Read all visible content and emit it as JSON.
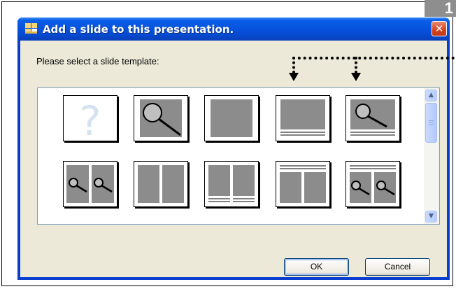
{
  "dialog": {
    "title": "Add a slide to this presentation.",
    "close_symbol": "✕",
    "prompt": "Please select a slide template:",
    "buttons": {
      "ok": "OK",
      "cancel": "Cancel"
    }
  },
  "corner_tab_text": "1",
  "templates": [
    {
      "name": "blank-question",
      "icon": "question-mark-icon"
    },
    {
      "name": "image-full",
      "icon": "magnifier-icon"
    },
    {
      "name": "full-gray",
      "icon": "gray-block-icon"
    },
    {
      "name": "gray-with-caption",
      "icon": "caption-lines-icon"
    },
    {
      "name": "image-with-caption",
      "icon": "magnifier-caption-icon"
    },
    {
      "name": "two-images",
      "icon": "two-magnifier-icon"
    },
    {
      "name": "two-columns",
      "icon": "two-columns-icon"
    },
    {
      "name": "two-columns-caption",
      "icon": "two-columns-caption-icon"
    },
    {
      "name": "header-two-columns",
      "icon": "header-columns-icon"
    },
    {
      "name": "header-two-images",
      "icon": "header-magnifiers-icon"
    }
  ],
  "colors": {
    "title_bar": "#0652dd",
    "dialog_bg": "#ece9d8",
    "close": "#d5411f",
    "thumb_gray": "#8c8c8c"
  }
}
